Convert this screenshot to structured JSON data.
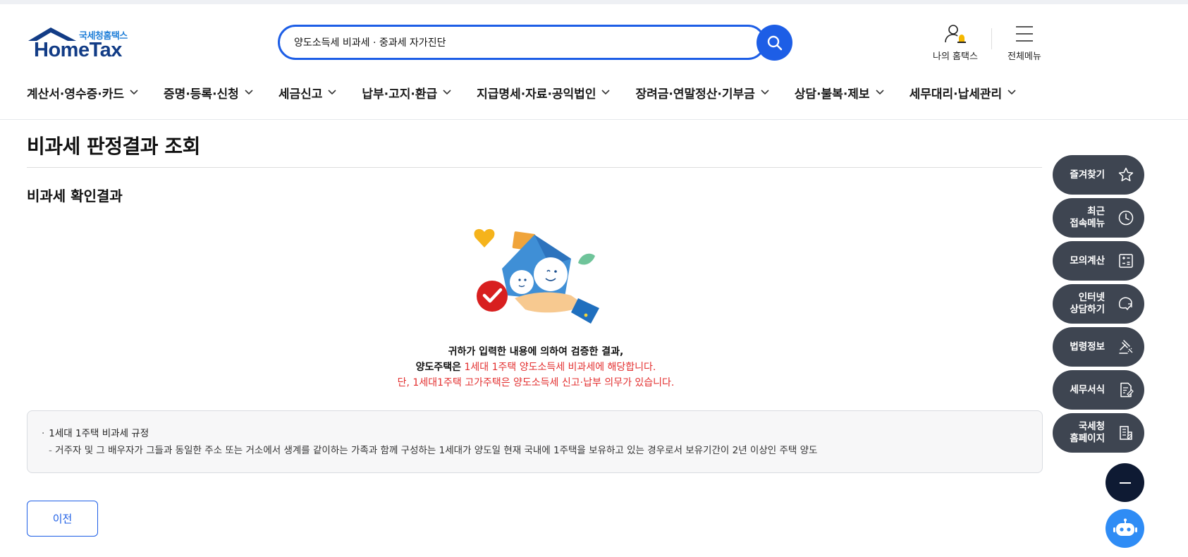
{
  "header": {
    "logo_sub": "국세청홈택스",
    "logo_main": "HomeTax",
    "search": {
      "value": "양도소득세 비과세 · 중과세 자가진단"
    },
    "my_hometax_label": "나의 홈택스",
    "all_menu_label": "전체메뉴"
  },
  "nav": {
    "items": [
      {
        "label": "계산서·영수증·카드"
      },
      {
        "label": "증명·등록·신청"
      },
      {
        "label": "세금신고"
      },
      {
        "label": "납부·고지·환급"
      },
      {
        "label": "지급명세·자료·공익법인"
      },
      {
        "label": "장려금·연말정산·기부금"
      },
      {
        "label": "상담·불복·제보"
      },
      {
        "label": "세무대리·납세관리"
      }
    ]
  },
  "main": {
    "page_title": "비과세 판정결과 조회",
    "section_title": "비과세 확인결과",
    "result": {
      "line1": "귀하가 입력한 내용에 의하여 검증한 결과,",
      "line2_subject": "양도주택은",
      "line2_red": "1세대 1주택 양도소득세 비과세에 해당합니다.",
      "line3_red": "단, 1세대1주택 고가주택은 양도소득세 신고·납부 의무가 있습니다."
    },
    "info": {
      "title": "1세대 1주택 비과세 규정",
      "text": "거주자 및 그 배우자가 그들과 동일한 주소 또는 거소에서 생계를 같이하는 가족과 함께 구성하는 1세대가 양도일 현재 국내에 1주택을 보유하고 있는 경우로서 보유기간이 2년 이상인 주택 양도"
    },
    "prev_button": "이전"
  },
  "quick_menu": {
    "items": [
      {
        "label": "즐겨찾기",
        "icon": "star-icon"
      },
      {
        "label": "최근\n접속메뉴",
        "icon": "clock-icon"
      },
      {
        "label": "모의계산",
        "icon": "calculator-icon"
      },
      {
        "label": "인터넷\n상담하기",
        "icon": "chat-icon"
      },
      {
        "label": "법령정보",
        "icon": "gavel-icon"
      },
      {
        "label": "세무서식",
        "icon": "document-icon"
      },
      {
        "label": "국세청\n홈페이지",
        "icon": "building-icon"
      }
    ],
    "collapse_icon": "minus-icon",
    "chatbot_icon": "chatbot-icon"
  },
  "colors": {
    "accent": "#1d5ee6",
    "brand_navy": "#123c86",
    "alert_red": "#e32f2f",
    "quick_bg": "#3e4551"
  }
}
